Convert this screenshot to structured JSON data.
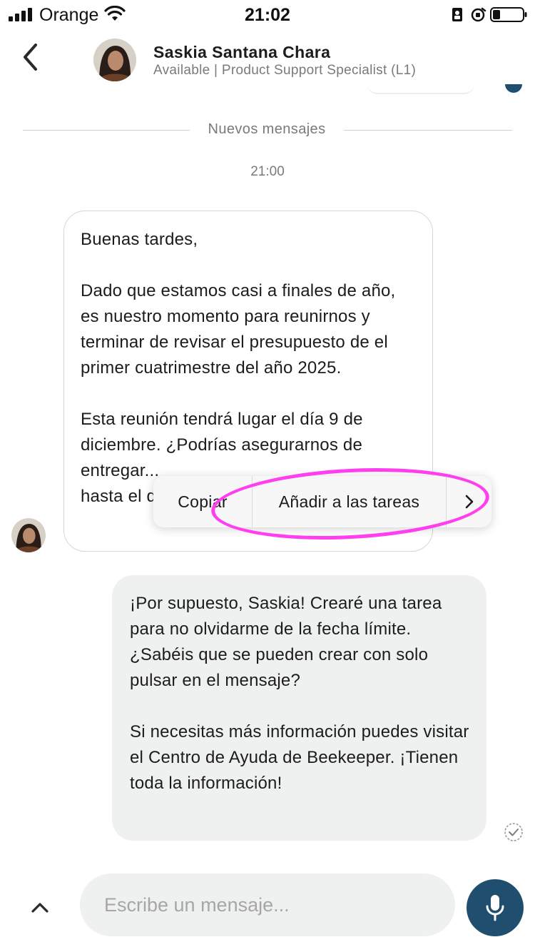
{
  "status_bar": {
    "carrier": "Orange",
    "time": "21:02"
  },
  "header": {
    "contact_name": "Saskia Santana Chara",
    "contact_status": "Available | Product Support Specialist (L1)"
  },
  "conversation": {
    "new_messages_label": "Nuevos mensajes",
    "timestamp": "21:00",
    "incoming_message": "Buenas tardes,\n\nDado que estamos casi a finales de año, es nuestro momento para reunirnos y terminar de revisar el presupuesto de el primer cuatrimestre del año 2025.\n\nEsta reunión tendrá lugar el día 9 de diciembre. ¿Podrías asegurarnos de entregar...\nhasta el d...",
    "outgoing_message": "¡Por supuesto, Saskia! Crearé una tarea para no olvidarme de la fecha límite. ¿Sabéis que se pueden crear con solo pulsar en el mensaje?\n\nSi necesitas más información puedes visitar el Centro de Ayuda de Beekeeper. ¡Tienen toda la información!"
  },
  "context_menu": {
    "copy_label": "Copiar",
    "add_task_label": "Añadir a las tareas"
  },
  "composer": {
    "placeholder": "Escribe un mensaje..."
  },
  "colors": {
    "accent": "#1f4e6e",
    "highlight": "#ff3ef0",
    "outgoing_bubble": "#eff1f1"
  },
  "icons": [
    "signal-bars-icon",
    "wifi-icon",
    "portrait-lock-icon",
    "alarm-icon",
    "battery-icon",
    "back-chevron-icon",
    "chevron-right-icon",
    "read-check-icon",
    "chevron-up-icon",
    "microphone-icon"
  ]
}
